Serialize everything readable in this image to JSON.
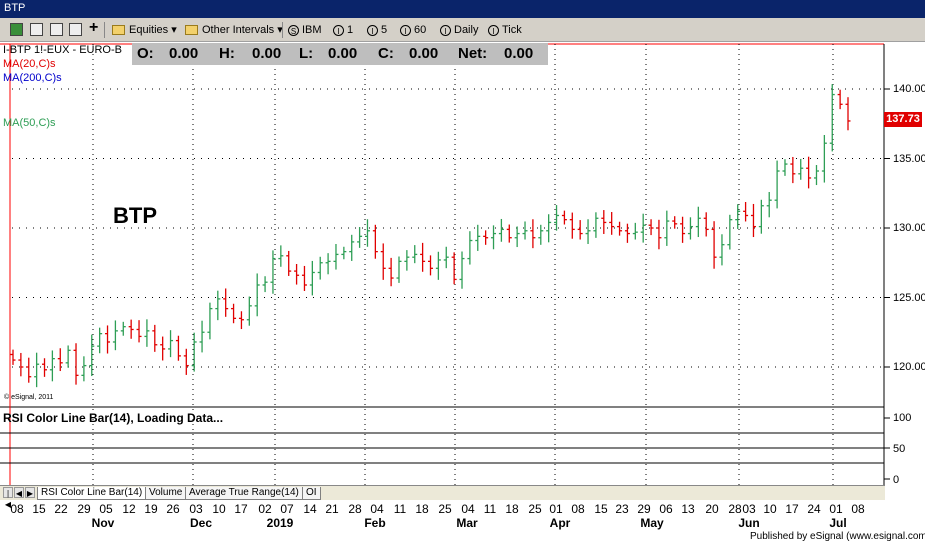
{
  "window": {
    "title": "BTP"
  },
  "toolbar": {
    "equities": "Equities",
    "other_intervals": "Other Intervals",
    "items": [
      "IBM",
      "1",
      "5",
      "60",
      "Daily",
      "Tick"
    ]
  },
  "legend": {
    "symbol_line": "I-BTP 1!-EUX - EURO-B",
    "ma20": "MA(20,C)s",
    "ma200": "MA(200,C)s",
    "ma50": "MA(50,C)s",
    "watermark": "© eSignal, 2011"
  },
  "ohlc": {
    "o_label": "O:",
    "o": "0.00",
    "h_label": "H:",
    "h": "0.00",
    "l_label": "L:",
    "l": "0.00",
    "c_label": "C:",
    "c": "0.00",
    "net_label": "Net:",
    "net": "0.00"
  },
  "big_symbol": "BTP",
  "last_price": "137.73",
  "rsi_title": "RSI Color Line Bar(14), Loading Data...",
  "tabs": [
    "RSI Color Line Bar(14)",
    "Volume",
    "Average True Range(14)",
    "OI"
  ],
  "published": "Published by eSignal (www.esignal.com)",
  "colors": {
    "up": "#2e9e55",
    "down": "#e00000",
    "accent_line": "#ff0000",
    "grid": "#000000",
    "ohlc_bg": "#bebebe"
  },
  "chart_data": {
    "type": "ohlc",
    "y_ticks": [
      "140.00",
      "135.00",
      "130.00",
      "125.00",
      "120.00"
    ],
    "ylim": [
      117.5,
      143.5
    ],
    "rsi_ticks": [
      "100",
      "50",
      "0"
    ],
    "x_day_labels": [
      "08",
      "15",
      "22",
      "29",
      "05",
      "12",
      "19",
      "26",
      "03",
      "10",
      "17",
      "02",
      "07",
      "14",
      "21",
      "28",
      "04",
      "11",
      "18",
      "25",
      "04",
      "11",
      "18",
      "25",
      "01",
      "08",
      "15",
      "23",
      "29",
      "06",
      "13",
      "20",
      "28",
      "03",
      "10",
      "17",
      "24",
      "01",
      "08"
    ],
    "x_month_labels": [
      "Nov",
      "Dec",
      "2019",
      "Feb",
      "Mar",
      "Apr",
      "May",
      "Jun",
      "Jul"
    ],
    "series": [
      {
        "values": [
          120.5,
          120.0,
          119.3,
          120.2,
          119.8,
          120.6,
          120.3,
          121.2,
          119.4,
          120.1,
          121.5,
          122.4,
          121.8,
          122.6,
          122.9,
          122.7,
          122.2,
          122.6,
          121.6,
          121.3,
          121.9,
          120.8,
          120.1,
          121.8,
          122.5,
          124.2,
          124.9,
          124.2,
          123.5,
          123.4,
          124.4,
          125.9,
          126.1,
          127.8,
          128.0,
          126.9,
          126.6,
          125.9,
          126.8,
          127.5,
          127.6,
          128.1,
          128.3,
          129.0,
          129.4,
          129.8,
          128.3,
          127.1,
          126.4,
          127.6,
          127.9,
          128.1,
          127.6,
          127.1,
          127.7,
          127.9,
          126.3,
          127.8,
          129.1,
          129.4,
          129.3,
          129.6,
          129.9,
          129.3,
          129.6,
          129.8,
          129.3,
          129.8,
          130.4,
          130.9,
          130.6,
          129.9,
          129.6,
          129.8,
          130.7,
          130.4,
          130.1,
          129.8,
          129.6,
          129.7,
          130.2,
          130.0,
          129.3,
          130.5,
          130.3,
          129.6,
          130.1,
          130.7,
          129.9,
          127.9,
          128.8,
          130.6,
          131.2,
          130.9,
          130.1,
          131.6,
          132.0,
          134.1,
          134.6,
          133.9,
          134.3,
          133.6,
          134.1,
          136.1,
          139.6,
          138.9,
          137.7
        ]
      }
    ]
  }
}
